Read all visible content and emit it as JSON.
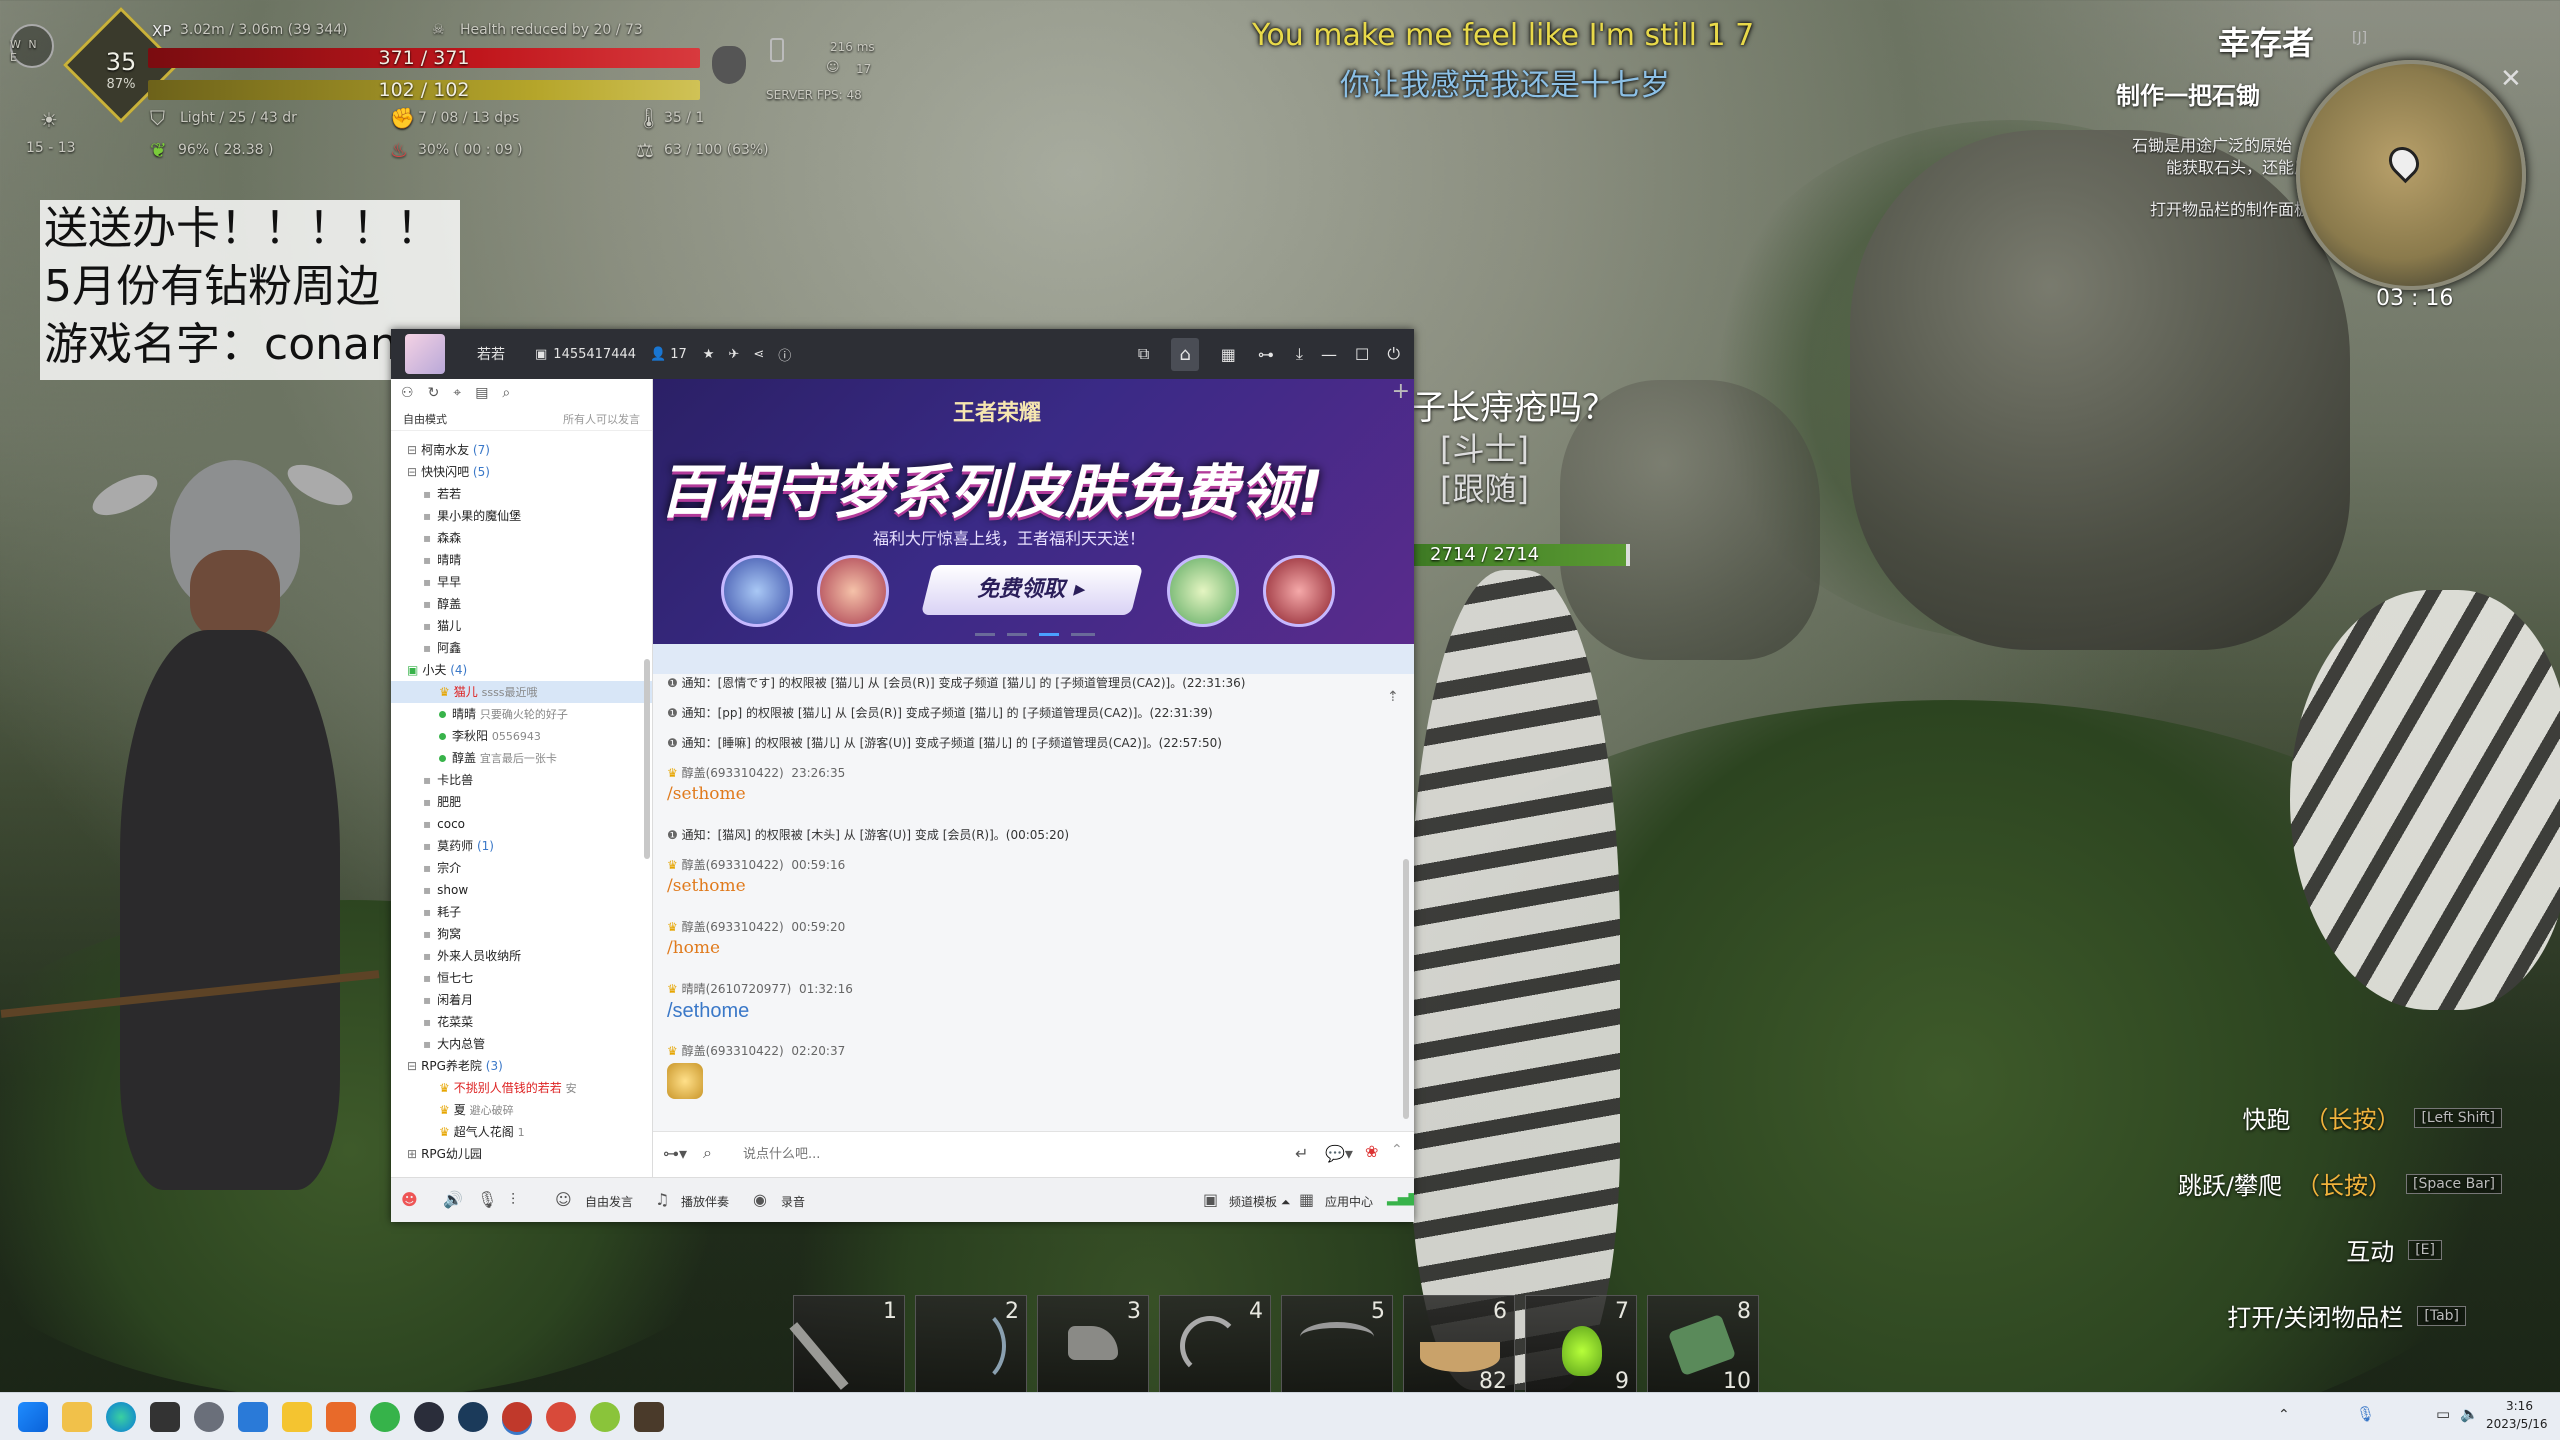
{
  "hud": {
    "level": "35",
    "level_pct": "87%",
    "xp_label": "XP",
    "xp_text": "3.02m / 3.06m (39 344)",
    "health_reduced": "Health reduced by 20 / 73",
    "health": "371 / 371",
    "stamina": "102 / 102",
    "light": "Light / 25 / 43 dr",
    "dps": "7 / 08 / 13 dps",
    "temp": "35 / 1",
    "food": "96% ( 28.38 )",
    "water": "30% ( 00 : 09 )",
    "weight": "63 / 100 (63%)",
    "coords": "15 - 13",
    "ping": "216 ms",
    "players": "17",
    "server_fps": "SERVER FPS: 48",
    "compass": "W  N  E"
  },
  "stream_overlay": {
    "lines": [
      "送送办卡！！！！！",
      "5月份有钻粉周边",
      "游戏名字：conan"
    ]
  },
  "subtitle": {
    "en": "You make me feel like I'm still  1  7",
    "zh": "你让我感觉我还是十七岁"
  },
  "right_panel": {
    "title": "幸存者",
    "title_key": "[J]",
    "quest_title": "制作一把石锄",
    "quest_lines": [
      "石锄是用途广泛的原始",
      "能获取石头，还能用",
      "打开物品栏的制作面板"
    ],
    "timer": "03 : 16"
  },
  "tiger": {
    "health": "2714 / 2714",
    "speech": "子长痔疮吗？",
    "tags": [
      "[斗士]",
      "[跟随]"
    ]
  },
  "hints": [
    {
      "label": "快跑",
      "extra": "（长按）",
      "key": "[Left Shift]"
    },
    {
      "label": "跳跃/攀爬",
      "extra": "（长按）",
      "key": "[Space Bar]"
    },
    {
      "label": "互动",
      "extra": "",
      "key": "[E]"
    },
    {
      "label": "打开/关闭物品栏",
      "extra": "",
      "key": "[Tab]"
    }
  ],
  "hotbar": [
    {
      "n": "1",
      "q": ""
    },
    {
      "n": "2",
      "q": ""
    },
    {
      "n": "3",
      "q": ""
    },
    {
      "n": "4",
      "q": ""
    },
    {
      "n": "5",
      "q": ""
    },
    {
      "n": "6",
      "q": "82"
    },
    {
      "n": "7",
      "q": "9"
    },
    {
      "n": "8",
      "q": "10"
    }
  ],
  "chat": {
    "channel_name": "若若",
    "channel_id": "1455417444",
    "online": "17",
    "mode": "自由模式",
    "mode_note": "所有人可以发言",
    "tree": [
      {
        "t": "柯南水友",
        "c": "(7)",
        "lvl": 0,
        "exp": true
      },
      {
        "t": "快快闪吧",
        "c": "(5)",
        "lvl": 0,
        "exp": true
      },
      {
        "t": "若若",
        "lvl": 1
      },
      {
        "t": "果小果的魔仙堡",
        "lvl": 1
      },
      {
        "t": "森森",
        "lvl": 1
      },
      {
        "t": "晴晴",
        "lvl": 1
      },
      {
        "t": "早早",
        "lvl": 1
      },
      {
        "t": "醇盖",
        "lvl": 1
      },
      {
        "t": "猫儿",
        "lvl": 1
      },
      {
        "t": "阿鑫",
        "lvl": 1
      },
      {
        "t": "小夫",
        "c": "(4)",
        "lvl": 0,
        "exp": true,
        "green": true
      },
      {
        "t": "猫儿",
        "note": "ssss最近哦",
        "lvl": 2,
        "sel": true,
        "red": true
      },
      {
        "t": "晴晴",
        "note": "只要确火轮的好子",
        "lvl": 2,
        "dot": true
      },
      {
        "t": "李秋阳",
        "note": "0556943",
        "lvl": 2,
        "dot": true
      },
      {
        "t": "醇盖",
        "note": "宜言最后一张卡",
        "lvl": 2,
        "dot": true
      },
      {
        "t": "卡比兽",
        "lvl": 1
      },
      {
        "t": "肥肥",
        "lvl": 1
      },
      {
        "t": "coco",
        "lvl": 1
      },
      {
        "t": "莫药师",
        "c": "(1)",
        "lvl": 1
      },
      {
        "t": "宗介",
        "lvl": 1
      },
      {
        "t": "show",
        "lvl": 1
      },
      {
        "t": "耗子",
        "lvl": 1
      },
      {
        "t": "狗窝",
        "lvl": 1
      },
      {
        "t": "外来人员收纳所",
        "lvl": 1
      },
      {
        "t": "恒七七",
        "lvl": 1
      },
      {
        "t": "闲着月",
        "lvl": 1
      },
      {
        "t": "花菜菜",
        "lvl": 1
      },
      {
        "t": "大内总管",
        "lvl": 1
      },
      {
        "t": "RPG养老院",
        "c": "(3)",
        "lvl": 0,
        "exp": true
      },
      {
        "t": "不挑别人借钱的若若",
        "note": "安",
        "lvl": 2,
        "red": true
      },
      {
        "t": "夏",
        "note": "避心破碎",
        "lvl": 2
      },
      {
        "t": "超气人花阁",
        "note": "1",
        "lvl": 2
      },
      {
        "t": "RPG幼儿园",
        "lvl": 0
      }
    ],
    "banner_logo": "王者荣耀",
    "banner_title": "百相守梦系列皮肤免费领!",
    "banner_sub": "福利大厅惊喜上线，王者福利天天送！",
    "banner_btn": "免费领取",
    "messages": [
      {
        "type": "notice",
        "text": "通知：[恩情です] 的权限被 [猫儿] 从 [会员(R)] 变成子频道 [猫儿] 的 [子频道管理员(CA2)]。(22:31:36)"
      },
      {
        "type": "notice",
        "text": "通知：[pp] 的权限被 [猫儿] 从 [会员(R)] 变成子频道 [猫儿] 的 [子频道管理员(CA2)]。(22:31:39)"
      },
      {
        "type": "notice",
        "text": "通知：[睡嘛] 的权限被 [猫儿] 从 [游客(U)] 变成子频道 [猫儿] 的 [子频道管理员(CA2)]。(22:57:50)"
      },
      {
        "type": "chat",
        "sender": "醇盖(693310422)",
        "time": "23:26:35",
        "text": "/sethome",
        "style": "cmd"
      },
      {
        "type": "notice",
        "text": "通知：[猫风] 的权限被 [木头] 从 [游客(U)] 变成 [会员(R)]。(00:05:20)"
      },
      {
        "type": "chat",
        "sender": "醇盖(693310422)",
        "time": "00:59:16",
        "text": "/sethome",
        "style": "cmd"
      },
      {
        "type": "chat",
        "sender": "醇盖(693310422)",
        "time": "00:59:20",
        "text": "/home",
        "style": "cmd"
      },
      {
        "type": "chat",
        "sender": "晴晴(2610720977)",
        "time": "01:32:16",
        "text": "/sethome",
        "style": "cmd2"
      },
      {
        "type": "chat",
        "sender": "醇盖(693310422)",
        "time": "02:20:37",
        "text": "",
        "style": "emoji"
      }
    ],
    "input_placeholder": "说点什么吧...",
    "bottom": {
      "free_talk": "自由发言",
      "bgm": "播放伴奏",
      "record": "录音",
      "template": "频道模板",
      "apps": "应用中心"
    }
  },
  "taskbar": {
    "time": "3:16",
    "date": "2023/5/16"
  },
  "colors": {
    "health": "#c0161c",
    "stamina": "#b5a52a",
    "accent_orange": "#e07a1c",
    "link_blue": "#3a78c8"
  }
}
